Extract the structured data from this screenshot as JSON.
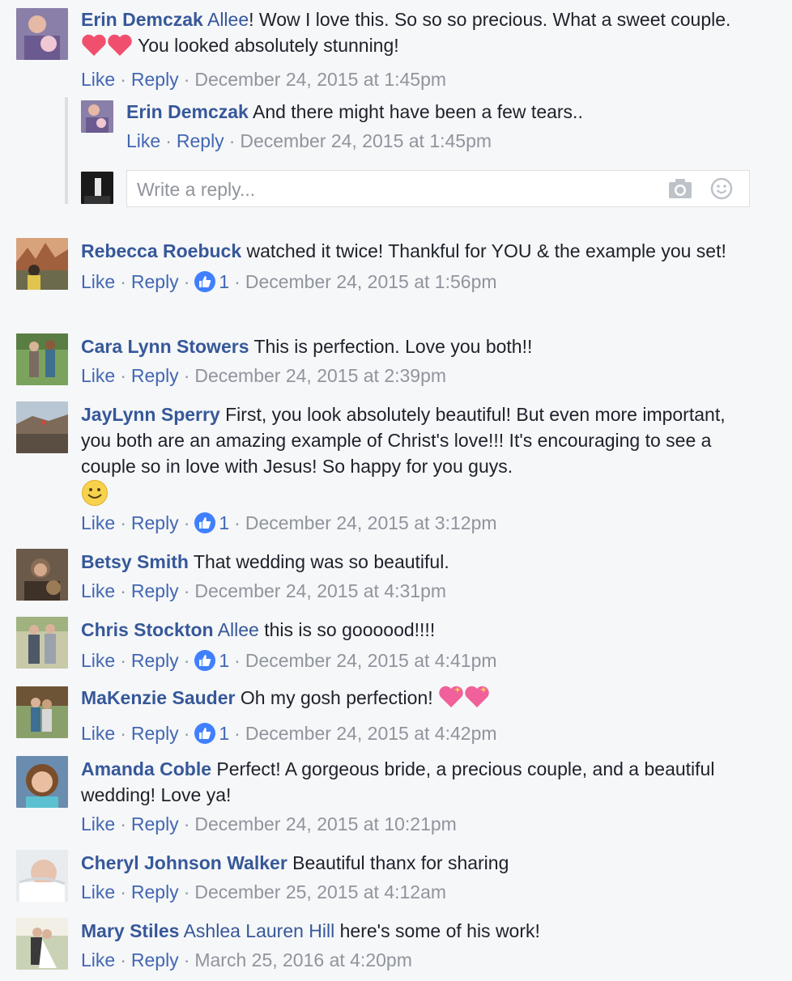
{
  "actions": {
    "like": "Like",
    "reply": "Reply"
  },
  "comments": [
    {
      "author": "Erin Demczak",
      "mention": "Allee",
      "text": "! Wow I love this. So so so precious. What a sweet couple.",
      "text2": "You looked absolutely stunning!",
      "likes": "",
      "time": "December 24, 2015 at 1:45pm"
    },
    {
      "author": "Rebecca Roebuck",
      "mention": "",
      "text": " watched it twice! Thankful for YOU & the example you set!",
      "likes": "1",
      "time": "December 24, 2015 at 1:56pm"
    },
    {
      "author": "Cara Lynn Stowers",
      "mention": "",
      "text": " This is perfection. Love you both!!",
      "likes": "",
      "time": "December 24, 2015 at 2:39pm"
    },
    {
      "author": "JayLynn Sperry",
      "mention": "",
      "text": " First, you look absolutely beautiful! But even more important, you both are an amazing example of Christ's love!!! It's encouraging to see a couple so in love with Jesus! So happy for you guys.",
      "likes": "1",
      "time": "December 24, 2015 at 3:12pm"
    },
    {
      "author": "Betsy Smith",
      "mention": "",
      "text": " That wedding was so beautiful.",
      "likes": "",
      "time": "December 24, 2015 at 4:31pm"
    },
    {
      "author": "Chris Stockton",
      "mention": "Allee",
      "text": " this is so goooood!!!!",
      "likes": "1",
      "time": "December 24, 2015 at 4:41pm"
    },
    {
      "author": "MaKenzie Sauder",
      "mention": "",
      "text": " Oh my gosh perfection!",
      "likes": "1",
      "time": "December 24, 2015 at 4:42pm"
    },
    {
      "author": "Amanda Coble",
      "mention": "",
      "text": " Perfect! A gorgeous bride, a precious couple, and a beautiful wedding! Love ya!",
      "likes": "",
      "time": "December 24, 2015 at 10:21pm"
    },
    {
      "author": "Cheryl Johnson Walker",
      "mention": "",
      "text": " Beautiful thanx for sharing",
      "likes": "",
      "time": "December 25, 2015 at 4:12am"
    },
    {
      "author": "Mary Stiles",
      "mention": "Ashlea Lauren Hill",
      "text": " here's some of his work!",
      "likes": "",
      "time": "March 25, 2016 at 4:20pm"
    }
  ],
  "reply": {
    "author": "Erin Demczak",
    "text": " And there might have been a few tears..",
    "time": "December 24, 2015 at 1:45pm"
  },
  "reply_box": {
    "placeholder": "Write a reply..."
  }
}
